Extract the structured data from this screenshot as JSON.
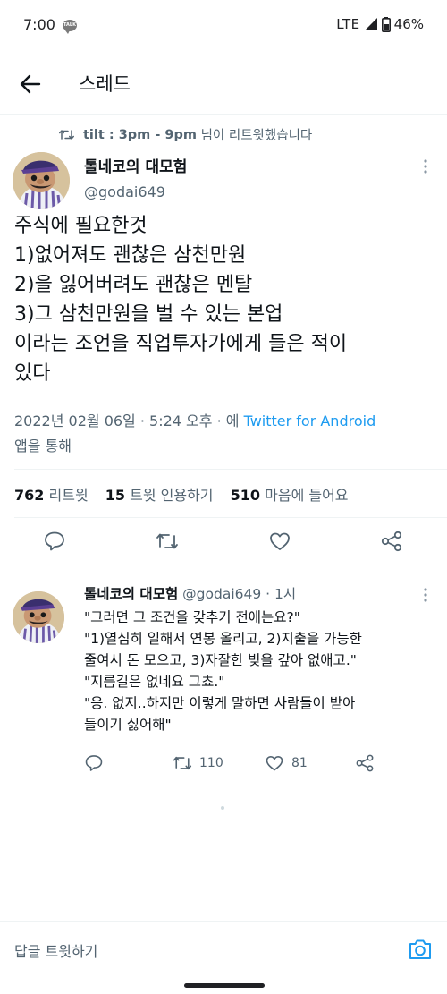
{
  "status_bar": {
    "time": "7:00",
    "talk_badge": "TALK",
    "network": "LTE",
    "battery": "46%",
    "icons": [
      "kakaotalk-notification-icon",
      "signal-icon",
      "battery-icon"
    ]
  },
  "app_bar": {
    "title": "스레드",
    "back_icon": "arrow-left-icon"
  },
  "retweet_context": {
    "icon": "retweet-icon",
    "name": "tilt : 3pm - 9pm",
    "suffix": " 님이 리트윗했습니다"
  },
  "main_tweet": {
    "author_name": "톨네코의 대모험",
    "author_handle": "@godai649",
    "text_lines": [
      "주식에 필요한것",
      "1)없어져도 괜찮은 삼천만원",
      "2)을 잃어버려도 괜찮은 멘탈",
      "3)그 삼천만원을 벌 수 있는 본업",
      "이라는 조언을 직업투자가에게 들은 적이",
      "있다"
    ],
    "timestamp": "2022년 02월 06일 · 5:24 오후 · 에",
    "source": "Twitter for Android",
    "source_suffix": "앱을 통해",
    "stats": {
      "retweets_count": "762",
      "retweets_label": "리트윗",
      "quotes_count": "15",
      "quotes_label": "트윗 인용하기",
      "likes_count": "510",
      "likes_label": "마음에 들어요"
    },
    "actions": [
      "reply-icon",
      "retweet-icon",
      "like-icon",
      "share-icon"
    ]
  },
  "reply_tweet": {
    "author_name": "톨네코의 대모험",
    "author_handle": "@godai649",
    "time": "· 1시",
    "text_lines": [
      "\"그러면 그 조건을 갖추기 전에는요?\"",
      "\"1)열심히 일해서 연봉 올리고, 2)지출을 가능한",
      "줄여서 돈 모으고, 3)자잘한 빚을 갚아 없애고.\"",
      "\"지름길은 없네요 그쵸.\"",
      "\"응. 없지..하지만 이렇게 말하면 사람들이 받아",
      "들이기 싫어해\""
    ],
    "retweets": "110",
    "likes": "81"
  },
  "compose": {
    "placeholder": "답글 트윗하기",
    "camera_icon": "camera-icon"
  },
  "colors": {
    "text": "#0f1419",
    "secondary": "#536471",
    "link": "#1d9bf0",
    "divider": "#eff3f4"
  }
}
